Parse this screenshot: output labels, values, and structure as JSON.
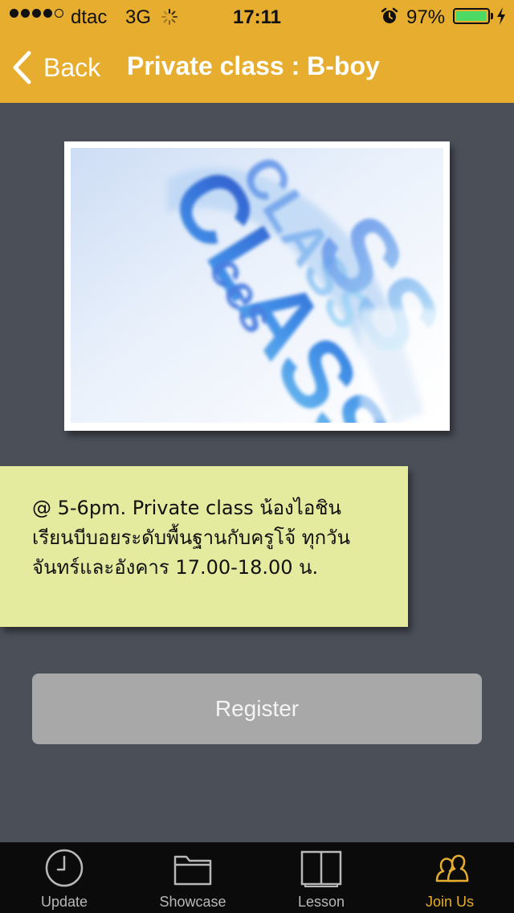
{
  "status_bar": {
    "carrier": "dtac",
    "network": "3G",
    "time": "17:11",
    "battery_percent": "97%",
    "battery_level": 0.97,
    "signal_bars": 4,
    "signal_total": 5
  },
  "nav": {
    "back_label": "Back",
    "title": "Private class : B-boy"
  },
  "content": {
    "image_icon": "class-promo-image",
    "description": "@ 5-6pm. Private class น้องไอชิน เรียนบีบอยระดับพื้นฐานกับครูโจ้ ทุกวันจันทร์และอังคาร 17.00-18.00 น.",
    "register_label": "Register"
  },
  "tab_bar": {
    "tabs": [
      {
        "label": "Update",
        "icon": "clock-icon",
        "active": false
      },
      {
        "label": "Showcase",
        "icon": "folder-icon",
        "active": false
      },
      {
        "label": "Lesson",
        "icon": "book-icon",
        "active": false
      },
      {
        "label": "Join Us",
        "icon": "users-icon",
        "active": true
      }
    ]
  },
  "colors": {
    "header": "#e6ad2e",
    "background": "#4b4f58",
    "note": "#e4eb9e",
    "button": "#a8a8a8",
    "tab_bar": "#0b0b0b",
    "active_tab": "#e6ad2e"
  }
}
